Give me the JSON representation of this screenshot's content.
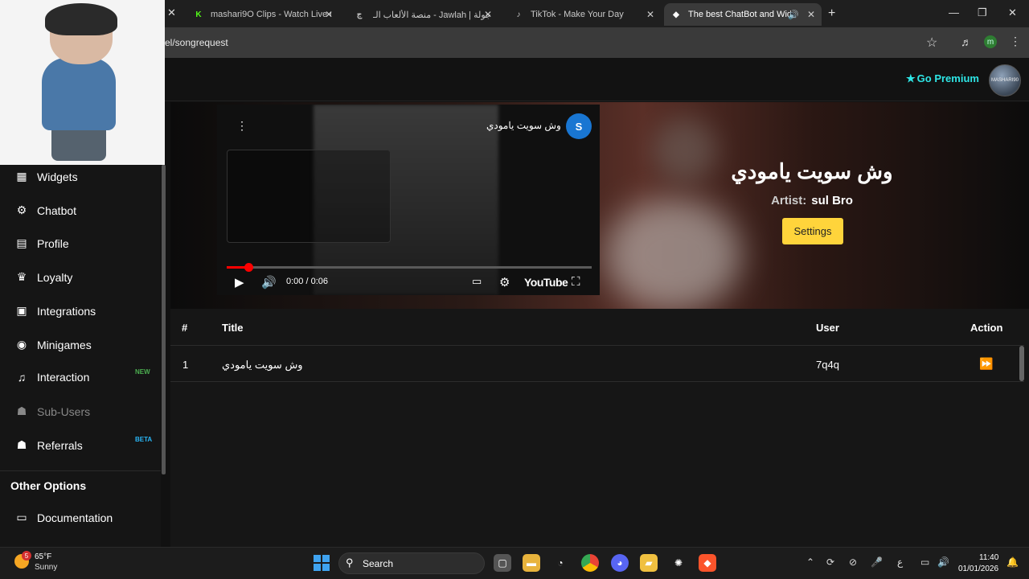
{
  "browser": {
    "tabs": [
      {
        "title": "mashari9O Clips - Watch Live o",
        "favicon": "kick-icon",
        "color": "#53fc18"
      },
      {
        "title": "منصة الألعاب الـ - Jawlah | جولة",
        "favicon": "jawlah-icon",
        "color": "#ffffff"
      },
      {
        "title": "TikTok - Make Your Day",
        "favicon": "tiktok-icon",
        "color": "#ffffff"
      },
      {
        "title": "The best ChatBot and Widg",
        "favicon": "botrix-icon",
        "color": "#ffffff"
      }
    ],
    "url": "el/songrequest",
    "profile_initial": "m"
  },
  "header": {
    "premium_label": "Go Premium",
    "avatar_text": "MASHARI90"
  },
  "sidebar": {
    "items": [
      {
        "label": "Widgets",
        "icon": "grid-icon",
        "glyph": "▦"
      },
      {
        "label": "Chatbot",
        "icon": "robot-icon",
        "glyph": "🤖"
      },
      {
        "label": "Profile",
        "icon": "id-card-icon",
        "glyph": "▤"
      },
      {
        "label": "Loyalty",
        "icon": "trophy-icon",
        "glyph": "🏆"
      },
      {
        "label": "Integrations",
        "icon": "plug-icon",
        "glyph": "▣"
      },
      {
        "label": "Minigames",
        "icon": "gamepad-icon",
        "glyph": "🎮"
      },
      {
        "label": "Interaction",
        "icon": "music-icon",
        "glyph": "♫",
        "badge": "NEW",
        "badge_color": "#4caf50"
      },
      {
        "label": "Sub-Users",
        "icon": "users-icon",
        "glyph": "👥",
        "muted": true
      },
      {
        "label": "Referrals",
        "icon": "user-group-icon",
        "glyph": "👥",
        "badge": "BETA",
        "badge_color": "#29b6f6"
      }
    ],
    "section_title": "Other Options",
    "documentation": {
      "label": "Documentation",
      "icon": "book-icon",
      "glyph": "▭"
    }
  },
  "player": {
    "channel_initial": "S",
    "video_title": "وش سويت يامودي",
    "time": "0:00 / 0:06",
    "brand": "YouTube",
    "progress": 0.06
  },
  "now_playing": {
    "title": "وش سويت يامودي",
    "artist_label": "Artist:",
    "artist": "sul Bro",
    "settings_label": "Settings"
  },
  "queue": {
    "columns": {
      "num": "#",
      "title": "Title",
      "user": "User",
      "action": "Action"
    },
    "rows": [
      {
        "num": "1",
        "title": "وش سويت يامودي",
        "user": "7q4q"
      }
    ]
  },
  "taskbar": {
    "weather_temp": "65°F",
    "weather_desc": "Sunny",
    "weather_badge": "5",
    "search_label": "Search",
    "language": "ع",
    "time": "11:40",
    "date": "01/01/2026"
  }
}
